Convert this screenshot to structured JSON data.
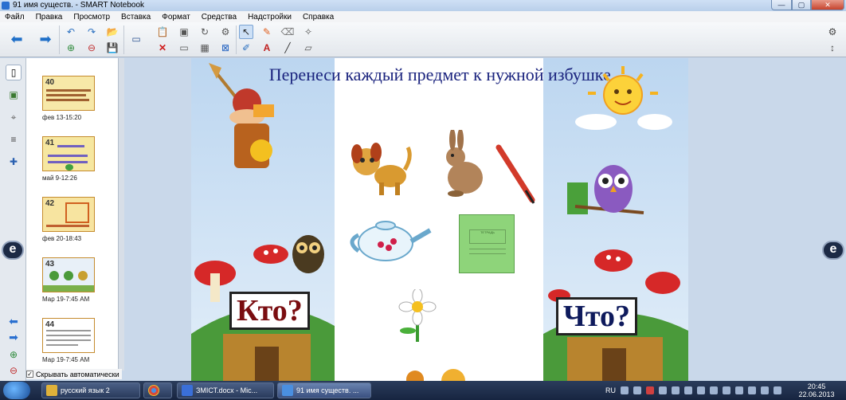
{
  "window": {
    "title": "91 имя существ. - SMART Notebook"
  },
  "menu": [
    "Файл",
    "Правка",
    "Просмотр",
    "Вставка",
    "Формат",
    "Средства",
    "Надстройки",
    "Справка"
  ],
  "sorter": {
    "pages": [
      {
        "num": "40",
        "label": "фев 13-15:20"
      },
      {
        "num": "41",
        "label": "май 9-12:26"
      },
      {
        "num": "42",
        "label": "фев 20-18:43"
      },
      {
        "num": "43",
        "label": "Мар 19-7:45 AM"
      },
      {
        "num": "44",
        "label": "Мар 19-7:45 AM"
      }
    ],
    "autohide_label": "Скрывать автоматически"
  },
  "slide": {
    "title": "Перенеси каждый предмет к нужной избушке.",
    "who_label": "Кто?",
    "what_label": "Что?",
    "notebook_text": "ТЕТРАДЬ"
  },
  "nav": {
    "prev_label": "e",
    "next_label": "e"
  },
  "taskbar": {
    "items": [
      {
        "label": "русский язык 2",
        "color": "#e0b23a"
      },
      {
        "label": "",
        "color": "#d84a38"
      },
      {
        "label": "ЗМІСТ.docx - Mic...",
        "color": "#3a6fd8"
      },
      {
        "label": "91 имя существ. ...",
        "color": "#4a8fe0"
      }
    ],
    "lang": "RU",
    "time": "20:45",
    "date": "22.06.2013"
  }
}
